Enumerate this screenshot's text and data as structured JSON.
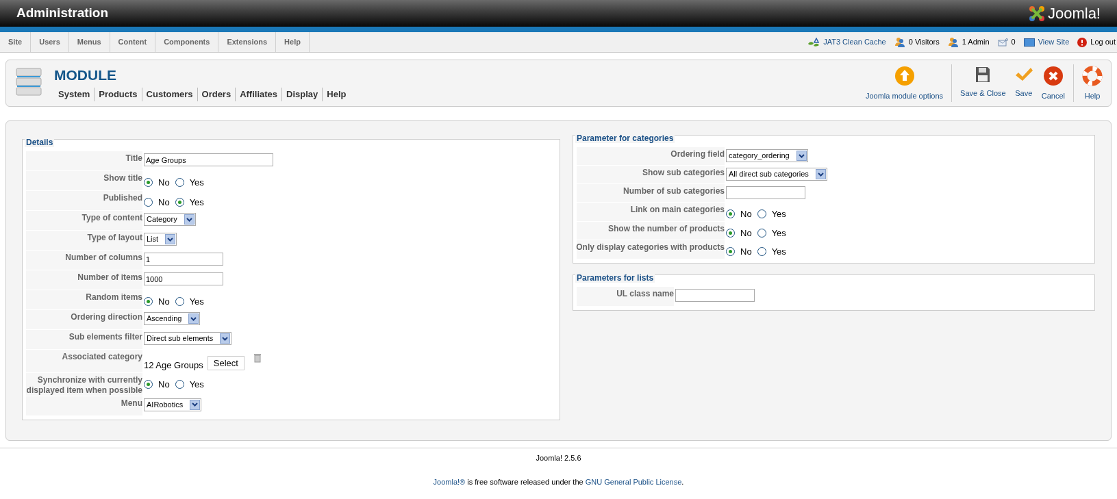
{
  "header": {
    "title": "Administration",
    "logo_text": "Joomla!"
  },
  "menu": [
    {
      "label": "Site"
    },
    {
      "label": "Users"
    },
    {
      "label": "Menus"
    },
    {
      "label": "Content"
    },
    {
      "label": "Components"
    },
    {
      "label": "Extensions"
    },
    {
      "label": "Help"
    }
  ],
  "status": [
    {
      "kind": "cache",
      "label": "JAT3 Clean Cache",
      "link": true
    },
    {
      "kind": "visitors",
      "label": "0 Visitors",
      "link": false
    },
    {
      "kind": "admins",
      "label": "1 Admin",
      "link": false
    },
    {
      "kind": "messages",
      "label": "0",
      "link": false
    },
    {
      "kind": "viewsite",
      "label": "View Site",
      "link": true
    },
    {
      "kind": "logout",
      "label": "Log out",
      "link": false
    }
  ],
  "toolbar": {
    "title": "MODULE",
    "submenu": [
      "System",
      "Products",
      "Customers",
      "Orders",
      "Affiliates",
      "Display",
      "Help"
    ],
    "buttons": [
      {
        "kind": "options",
        "label": "Joomla module options"
      },
      {
        "kind": "saveclose",
        "label": "Save & Close"
      },
      {
        "kind": "save",
        "label": "Save"
      },
      {
        "kind": "cancel",
        "label": "Cancel"
      },
      {
        "kind": "help",
        "label": "Help"
      }
    ]
  },
  "details": {
    "legend": "Details",
    "rows": [
      {
        "kind": "widetext",
        "label": "Title",
        "value": "Age Groups"
      },
      {
        "kind": "radio",
        "label": "Show title",
        "options": [
          {
            "label": "No",
            "selected": true
          },
          {
            "label": "Yes",
            "selected": false
          }
        ]
      },
      {
        "kind": "radio",
        "label": "Published",
        "options": [
          {
            "label": "No",
            "selected": false
          },
          {
            "label": "Yes",
            "selected": true
          }
        ]
      },
      {
        "kind": "select",
        "label": "Type of content",
        "value": "Category"
      },
      {
        "kind": "select",
        "label": "Type of layout",
        "value": "List"
      },
      {
        "kind": "text",
        "label": "Number of columns",
        "value": "1"
      },
      {
        "kind": "text",
        "label": "Number of items",
        "value": "1000"
      },
      {
        "kind": "radio",
        "label": "Random items",
        "options": [
          {
            "label": "No",
            "selected": true
          },
          {
            "label": "Yes",
            "selected": false
          }
        ]
      },
      {
        "kind": "select",
        "label": "Ordering direction",
        "value": "Ascending"
      },
      {
        "kind": "select",
        "label": "Sub elements filter",
        "value": "Direct sub elements"
      },
      {
        "kind": "category",
        "label": "Associated category",
        "value": "12 Age Groups",
        "button": "Select"
      },
      {
        "kind": "radio",
        "label": "Synchronize with currently displayed item when possible",
        "options": [
          {
            "label": "No",
            "selected": true
          },
          {
            "label": "Yes",
            "selected": false
          }
        ]
      },
      {
        "kind": "select",
        "label": "Menu",
        "value": "AIRobotics"
      }
    ]
  },
  "categories": {
    "legend": "Parameter for categories",
    "rows": [
      {
        "kind": "select",
        "label": "Ordering field",
        "value": "category_ordering"
      },
      {
        "kind": "select",
        "label": "Show sub categories",
        "value": "All direct sub categories"
      },
      {
        "kind": "text",
        "label": "Number of sub categories",
        "value": ""
      },
      {
        "kind": "radio",
        "label": "Link on main categories",
        "options": [
          {
            "label": "No",
            "selected": true
          },
          {
            "label": "Yes",
            "selected": false
          }
        ]
      },
      {
        "kind": "radio",
        "label": "Show the number of products",
        "options": [
          {
            "label": "No",
            "selected": true
          },
          {
            "label": "Yes",
            "selected": false
          }
        ]
      },
      {
        "kind": "radio",
        "label": "Only display categories with products",
        "options": [
          {
            "label": "No",
            "selected": true
          },
          {
            "label": "Yes",
            "selected": false
          }
        ]
      }
    ]
  },
  "lists": {
    "legend": "Parameters for lists",
    "rows": [
      {
        "kind": "text",
        "label": "UL class name",
        "value": ""
      }
    ]
  },
  "footer": {
    "version": "Joomla! 2.5.6",
    "license": [
      {
        "text": "Joomla!®",
        "link": true
      },
      {
        "text": " is free software released under the ",
        "link": false
      },
      {
        "text": "GNU General Public License",
        "link": true
      },
      {
        "text": ".",
        "link": false
      }
    ]
  }
}
